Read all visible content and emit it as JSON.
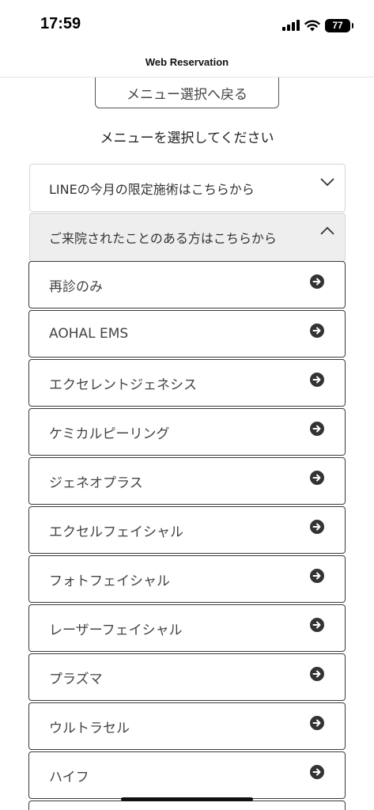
{
  "status_bar": {
    "time": "17:59",
    "battery_level": "77"
  },
  "header": {
    "title": "Web Reservation"
  },
  "back_button": {
    "label": "メニュー選択へ戻る"
  },
  "instruction": "メニューを選択してください",
  "accordions": [
    {
      "label": "LINEの今月の限定施術はこちらから",
      "state": "collapsed"
    },
    {
      "label": "ご来院されたことのある方はこちらから",
      "state": "expanded"
    }
  ],
  "menu_items": [
    {
      "label": "再診のみ"
    },
    {
      "label": "AOHAL EMS"
    },
    {
      "label": "エクセレントジェネシス"
    },
    {
      "label": "ケミカルピーリング"
    },
    {
      "label": "ジェネオプラス"
    },
    {
      "label": "エクセルフェイシャル"
    },
    {
      "label": "フォトフェイシャル"
    },
    {
      "label": "レーザーフェイシャル"
    },
    {
      "label": "プラズマ"
    },
    {
      "label": "ウルトラセル"
    },
    {
      "label": "ハイフ"
    }
  ],
  "colors": {
    "accent_dark": "#333333",
    "expanded_bg": "#eeeeee",
    "border": "#3a3a3a"
  }
}
